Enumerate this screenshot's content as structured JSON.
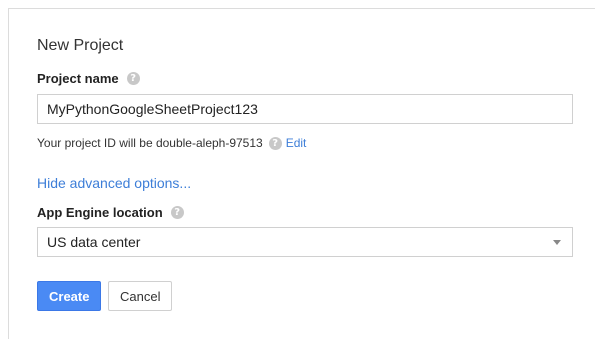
{
  "dialog": {
    "title": "New Project",
    "project_name": {
      "label": "Project name",
      "help_icon": "help-icon",
      "value": "MyPythonGoogleSheetProject123"
    },
    "project_id": {
      "prefix": "Your project ID will be double-aleph-97513",
      "help_icon": "help-icon",
      "edit_label": "Edit"
    },
    "advanced_link": "Hide advanced options...",
    "app_engine": {
      "label": "App Engine location",
      "help_icon": "help-icon",
      "selected": "US data center",
      "dropdown_icon": "caret-down-icon"
    },
    "buttons": {
      "create": "Create",
      "cancel": "Cancel"
    }
  },
  "colors": {
    "link": "#3d7ed8",
    "primary_button": "#4a8af4",
    "help_icon": "#c8c8c8",
    "border": "#d0d0d0"
  }
}
